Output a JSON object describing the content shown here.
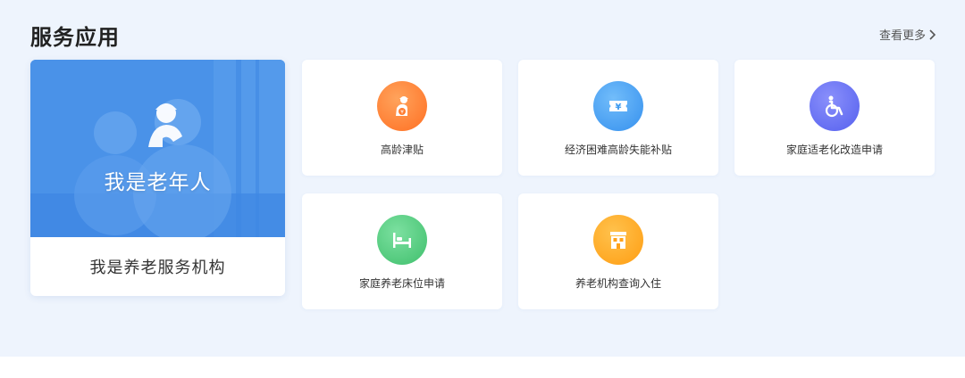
{
  "header": {
    "title": "服务应用",
    "more_label": "查看更多"
  },
  "roles": {
    "elder_label": "我是老年人",
    "org_label": "我是养老服务机构"
  },
  "services": [
    {
      "label": "高龄津贴",
      "icon": "elderly-allowance-icon",
      "color": "#ff7b2e"
    },
    {
      "label": "经济困难高龄失能补贴",
      "icon": "yuan-ticket-icon",
      "color": "#3d9bf0"
    },
    {
      "label": "家庭适老化改造申请",
      "icon": "wheelchair-icon",
      "color": "#6069f0"
    },
    {
      "label": "家庭养老床位申请",
      "icon": "bed-icon",
      "color": "#4cc97a"
    },
    {
      "label": "养老机构查询入住",
      "icon": "building-icon",
      "color": "#ffa21a"
    }
  ]
}
